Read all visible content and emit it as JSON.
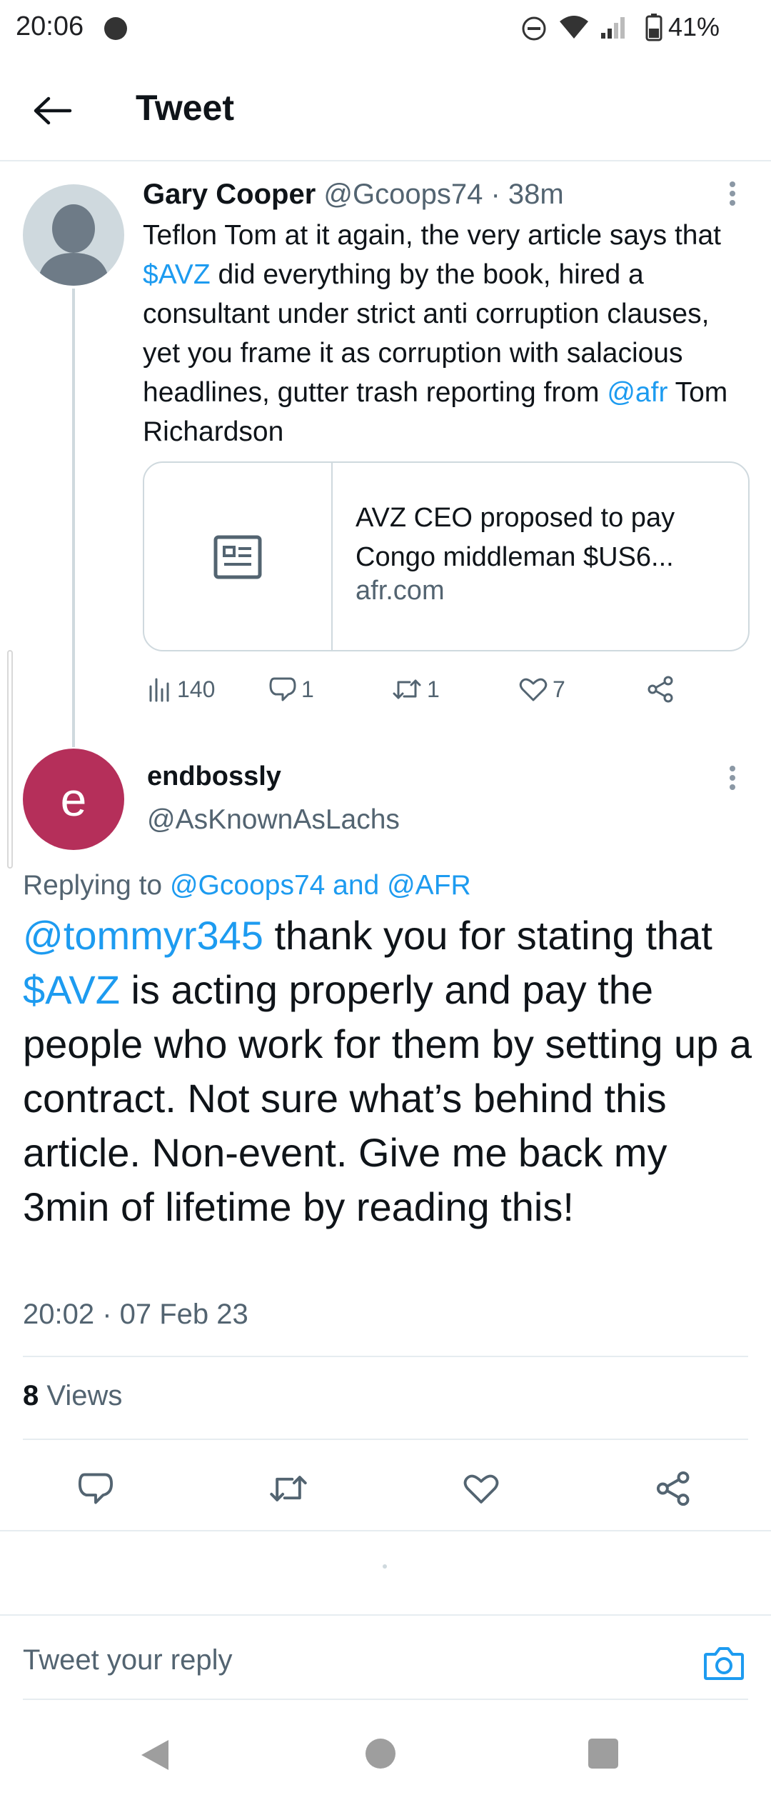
{
  "status_bar": {
    "time": "20:06",
    "battery": "41%"
  },
  "header": {
    "title": "Tweet"
  },
  "tweet1": {
    "name": "Gary Cooper",
    "handle": "@Gcoops74",
    "sep": " · ",
    "age": "38m",
    "text_parts": {
      "p1": "Teflon Tom at it again, the very article says that ",
      "cashtag": "$AVZ",
      "p2": " did everything by the book, hired a consultant under strict anti corruption clauses, yet you frame it as corruption with salacious headlines, gutter trash reporting from ",
      "mention": "@afr",
      "p3": " Tom Richardson"
    },
    "card": {
      "title": "AVZ CEO proposed to pay Congo middleman $US6...",
      "domain": "afr.com"
    },
    "stats": {
      "views": "140",
      "replies": "1",
      "retweets": "1",
      "likes": "7"
    }
  },
  "tweet2": {
    "avatar_letter": "e",
    "name": "endbossly",
    "handle": "@AsKnownAsLachs",
    "replying_label": "Replying to ",
    "replying_to_1": "@Gcoops74",
    "replying_and": " and ",
    "replying_to_2": "@AFR",
    "text_parts": {
      "mention": "@tommyr345",
      "p1": " thank you for stating that ",
      "cashtag": "$AVZ",
      "p2": " is acting properly and pay the people who work for them by setting up a contract. Not sure what’s behind this article. Non-event. Give me back my 3min of lifetime by reading this!"
    },
    "timestamp": "20:02 · 07 Feb 23",
    "views_count": "8",
    "views_label": " Views"
  },
  "reply_box": {
    "placeholder": "Tweet your reply"
  },
  "colors": {
    "accent": "#1d9bf0",
    "avatar_e": "#b52f5a",
    "text_secondary": "#536471"
  },
  "icons": [
    "back-arrow-icon",
    "more-icon",
    "article-icon",
    "views-icon",
    "reply-icon",
    "retweet-icon",
    "like-icon",
    "share-icon",
    "camera-icon"
  ]
}
